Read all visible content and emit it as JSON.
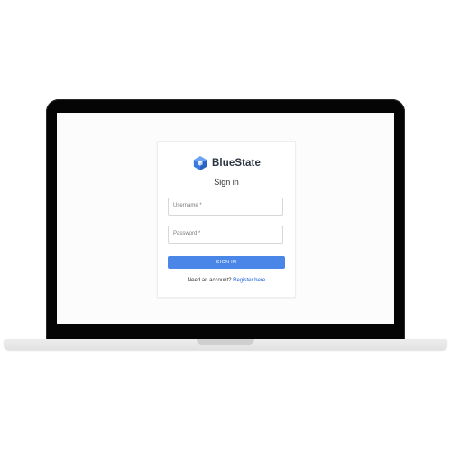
{
  "brand": {
    "name": "BlueState",
    "logo_icon": "hexagon-cube-logo-icon",
    "accent_color": "#4a86e8"
  },
  "login": {
    "title": "Sign in",
    "username_label": "Username *",
    "password_label": "Password *",
    "submit_label": "SIGN IN",
    "register_prompt": "Need an account?",
    "register_link": "Register here"
  }
}
